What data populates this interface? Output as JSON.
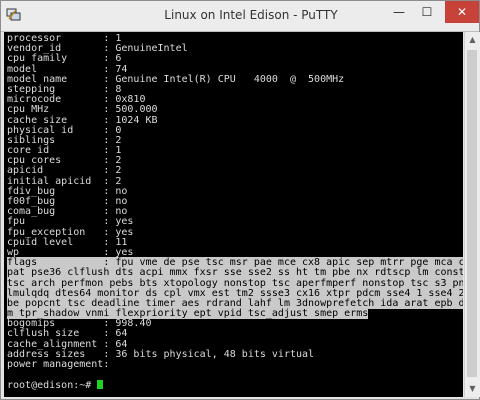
{
  "window": {
    "title": "Linux on Intel Edison - PuTTY",
    "minimize_glyph": "—",
    "maximize_glyph": "☐",
    "close_glyph": "✕"
  },
  "cpuinfo": [
    {
      "key": "processor",
      "value": "1"
    },
    {
      "key": "vendor_id",
      "value": "GenuineIntel"
    },
    {
      "key": "cpu family",
      "value": "6"
    },
    {
      "key": "model",
      "value": "74"
    },
    {
      "key": "model name",
      "value": "Genuine Intel(R) CPU   4000  @  500MHz"
    },
    {
      "key": "stepping",
      "value": "8"
    },
    {
      "key": "microcode",
      "value": "0x810"
    },
    {
      "key": "cpu MHz",
      "value": "500.000"
    },
    {
      "key": "cache size",
      "value": "1024 KB"
    },
    {
      "key": "physical id",
      "value": "0"
    },
    {
      "key": "siblings",
      "value": "2"
    },
    {
      "key": "core id",
      "value": "1"
    },
    {
      "key": "cpu cores",
      "value": "2"
    },
    {
      "key": "apicid",
      "value": "2"
    },
    {
      "key": "initial apicid",
      "value": "2"
    },
    {
      "key": "fdiv_bug",
      "value": "no"
    },
    {
      "key": "f00f_bug",
      "value": "no"
    },
    {
      "key": "coma_bug",
      "value": "no"
    },
    {
      "key": "fpu",
      "value": "yes"
    },
    {
      "key": "fpu_exception",
      "value": "yes"
    },
    {
      "key": "cpuid level",
      "value": "11"
    },
    {
      "key": "wp",
      "value": "yes"
    }
  ],
  "flags": {
    "key": "flags",
    "first": "fpu vme de pse tsc msr pae mce cx8 apic sep mtrr pge mca cmov",
    "continuation": [
      "pat pse36 clflush dts acpi mmx fxsr sse sse2 ss ht tm pbe nx rdtscp lm constant_",
      "tsc arch_perfmon pebs bts xtopology nonstop_tsc aperfmperf nonstop_tsc_s3 pni pc",
      "lmulqdq dtes64 monitor ds_cpl vmx est tm2 ssse3 cx16 xtpr pdcm sse4_1 sse4_2 mov",
      "be popcnt tsc_deadline_timer aes rdrand lahf_lm 3dnowprefetch ida arat epb dther",
      "m tpr_shadow vnmi flexpriority ept vpid tsc_adjust smep erms"
    ]
  },
  "cpuinfo_tail": [
    {
      "key": "bogomips",
      "value": "998.40"
    },
    {
      "key": "clflush size",
      "value": "64"
    },
    {
      "key": "cache_alignment",
      "value": "64"
    },
    {
      "key": "address sizes",
      "value": "36 bits physical, 48 bits virtual"
    },
    {
      "key": "power management",
      "value": ""
    }
  ],
  "prompt": "root@edison:~# "
}
